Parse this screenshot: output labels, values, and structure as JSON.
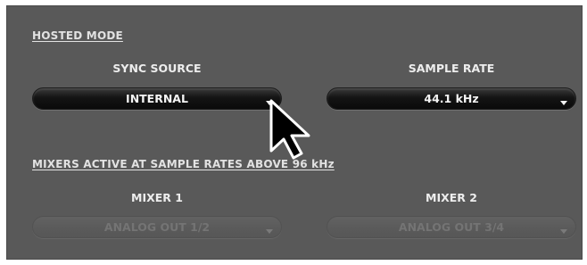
{
  "hosted_mode": {
    "title": "HOSTED MODE",
    "sync_source": {
      "label": "SYNC SOURCE",
      "value": "INTERNAL"
    },
    "sample_rate": {
      "label": "SAMPLE RATE",
      "value": "44.1 kHz"
    }
  },
  "mixers": {
    "title": "MIXERS ACTIVE AT SAMPLE RATES ABOVE 96 kHz",
    "mixer1": {
      "label": "MIXER 1",
      "value": "ANALOG OUT 1/2",
      "enabled": false
    },
    "mixer2": {
      "label": "MIXER 2",
      "value": "ANALOG OUT 3/4",
      "enabled": false
    }
  },
  "colors": {
    "panel_bg": "#595959",
    "active_dropdown_bg": "#0f0f0f",
    "disabled_dropdown_bg": "#5e5e5e",
    "text": "#ededed",
    "disabled_text": "#747474"
  },
  "icons": {
    "cursor": "mouse-pointer-icon",
    "dropdown_arrow": "triangle-down-icon"
  }
}
